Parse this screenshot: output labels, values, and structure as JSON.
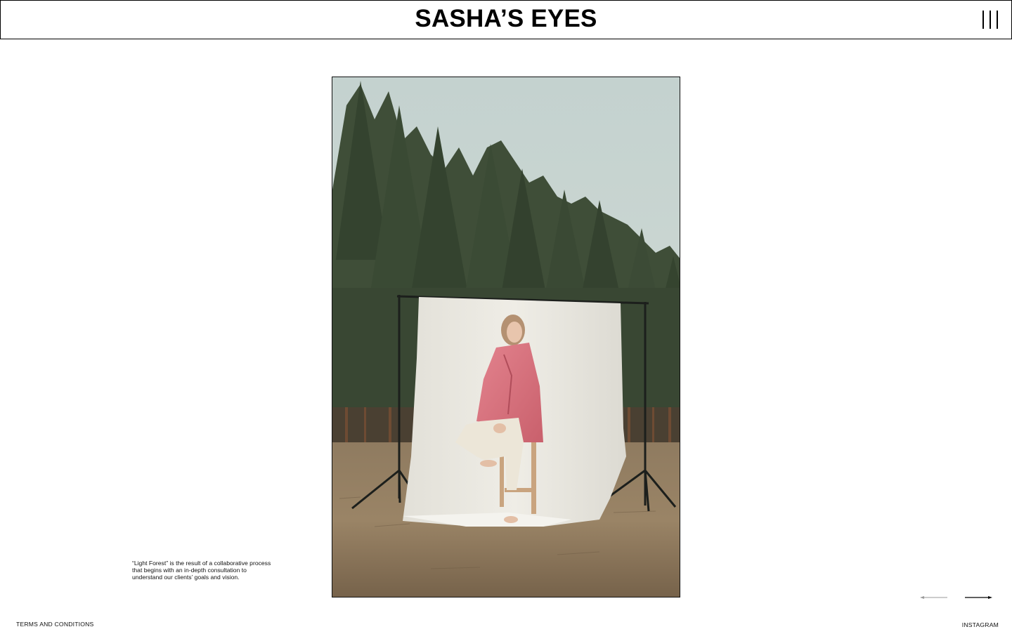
{
  "header": {
    "brand": "SASHA’S EYES",
    "menu_icon": "menu-bars-icon"
  },
  "gallery": {
    "photo_alt": "Light Forest",
    "caption": "“Light Forest” is the result of a collaborative process that begins with an in-depth consultation to understand our clients’ goals and vision.",
    "prev_icon": "arrow-left-icon",
    "next_icon": "arrow-right-icon"
  },
  "footer": {
    "terms": "TERMS AND CONDITIONS",
    "instagram": "INSTAGRAM"
  },
  "colors": {
    "text": "#000000",
    "background": "#ffffff",
    "prev_arrow": "#9a9a9a",
    "next_arrow": "#000000"
  }
}
